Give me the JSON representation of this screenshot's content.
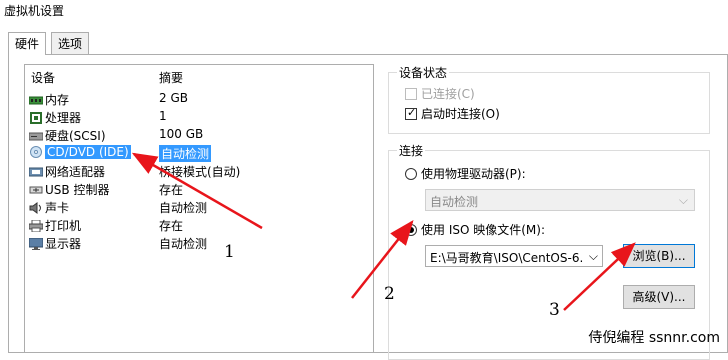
{
  "window": {
    "title": "虚拟机设置"
  },
  "tabs": [
    {
      "label": "硬件",
      "active": true
    },
    {
      "label": "选项",
      "active": false
    }
  ],
  "device_list": {
    "header": {
      "device": "设备",
      "summary": "摘要"
    },
    "rows": [
      {
        "device": "内存",
        "summary": "2 GB",
        "icon": "memory-icon",
        "selected": false
      },
      {
        "device": "处理器",
        "summary": "1",
        "icon": "processor-icon",
        "selected": false
      },
      {
        "device": "硬盘(SCSI)",
        "summary": "100 GB",
        "icon": "hard-disk-icon",
        "selected": false
      },
      {
        "device": "CD/DVD (IDE)",
        "summary": "自动检测",
        "icon": "cd-dvd-icon",
        "selected": true
      },
      {
        "device": "网络适配器",
        "summary": "桥接模式(自动)",
        "icon": "network-adapter-icon",
        "selected": false
      },
      {
        "device": "USB 控制器",
        "summary": "存在",
        "icon": "usb-icon",
        "selected": false
      },
      {
        "device": "声卡",
        "summary": "自动检测",
        "icon": "speaker-icon",
        "selected": false
      },
      {
        "device": "打印机",
        "summary": "存在",
        "icon": "printer-icon",
        "selected": false
      },
      {
        "device": "显示器",
        "summary": "自动检测",
        "icon": "monitor-icon",
        "selected": false
      }
    ]
  },
  "device_status": {
    "legend": "设备状态",
    "connected": {
      "label": "已连接(C)",
      "checked": false,
      "enabled": false
    },
    "connect_on_power": {
      "label": "启动时连接(O)",
      "checked": true
    }
  },
  "connection": {
    "legend": "连接",
    "physical_drive": {
      "label": "使用物理驱动器(P):",
      "selected": false
    },
    "physical_drive_select": {
      "value": "自动检测"
    },
    "iso_image": {
      "label": "使用 ISO 映像文件(M):",
      "selected": true
    },
    "iso_path": {
      "value": "E:\\马哥教育\\ISO\\CentOS-6."
    },
    "browse_button": "浏览(B)...",
    "advanced_button": "高级(V)..."
  },
  "annotations": {
    "n1": "1",
    "n2": "2",
    "n3": "3"
  },
  "watermark": "侍倪编程 ssnnr.com",
  "colors": {
    "selection": "#3399ff",
    "arrow": "#e8151b",
    "focus": "#0078d7"
  }
}
